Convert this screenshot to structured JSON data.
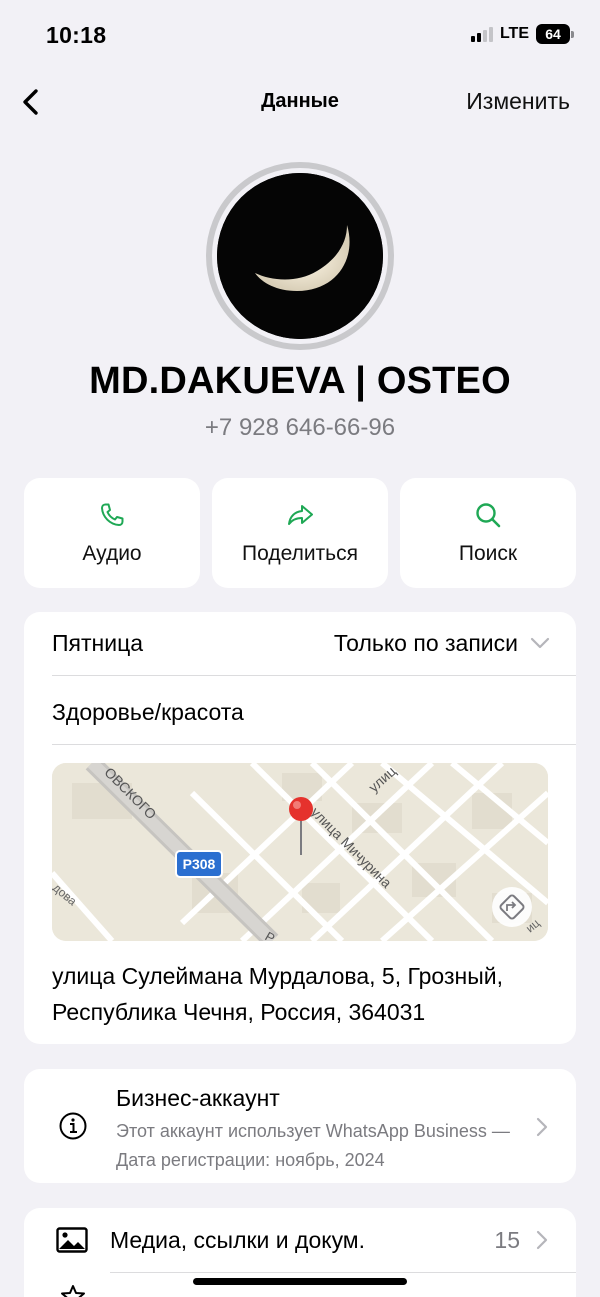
{
  "status_bar": {
    "time": "10:18",
    "network": "LTE",
    "battery": "64"
  },
  "nav": {
    "title": "Данные",
    "edit_label": "Изменить"
  },
  "profile": {
    "name": "MD.DAKUEVA | OSTEO",
    "phone": "+7 928 646-66-96"
  },
  "actions": [
    {
      "label": "Аудио",
      "icon": "phone-icon"
    },
    {
      "label": "Поделиться",
      "icon": "share-icon"
    },
    {
      "label": "Поиск",
      "icon": "search-icon"
    }
  ],
  "business_info": {
    "day": "Пятница",
    "hours": "Только по записи",
    "category": "Здоровье/красота",
    "map": {
      "road_badge": "Р308",
      "street_labels": [
        "ОВСКОГО",
        "улица Мичурина",
        "улиц",
        "дова",
        "Р",
        "иц"
      ]
    },
    "address": "улица Сулеймана Мурдалова, 5, Грозный, Республика Чечня, Россия, 364031"
  },
  "business_account": {
    "title": "Бизнес-аккаунт",
    "description": "Этот аккаунт использует WhatsApp Business — Дата регистрации: ноябрь, 2024"
  },
  "media": {
    "label": "Медиа, ссылки и докум.",
    "count": "15"
  },
  "colors": {
    "accent_green": "#1fa855",
    "background": "#f2f1f6",
    "secondary_text": "#7b7b80",
    "map_pin": "#e5322d"
  }
}
